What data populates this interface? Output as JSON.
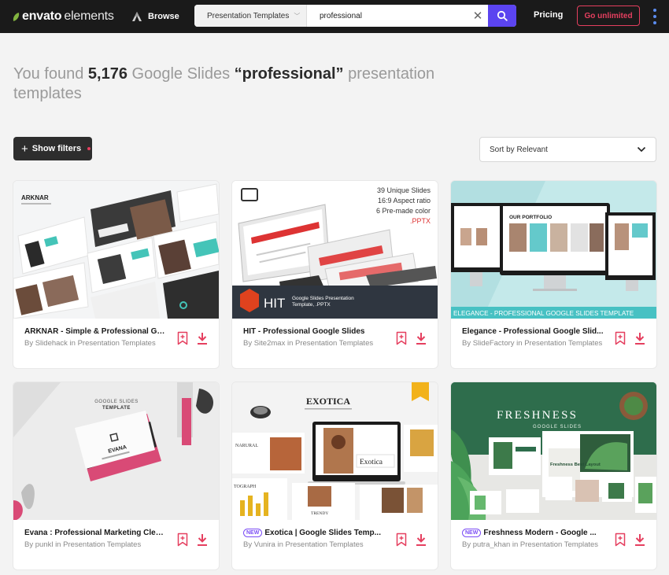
{
  "header": {
    "logo_envato": "envato",
    "logo_elements": "elements",
    "browse_label": "Browse",
    "search_category": "Presentation Templates",
    "search_value": "professional",
    "pricing_label": "Pricing",
    "go_unlimited_label": "Go unlimited"
  },
  "results": {
    "prefix": "You found ",
    "count": "5,176",
    "middle": " Google Slides ",
    "query": "“professional”",
    "suffix": " presentation templates"
  },
  "toolbar": {
    "filters_label": "Show filters",
    "sort_label": "Sort by Relevant"
  },
  "cards": [
    {
      "title": "ARKNAR - Simple & Professional Go...",
      "by": "By Slidehack in Presentation Templates",
      "is_new": false,
      "new_label": ""
    },
    {
      "title": "HIT - Professional Google Slides",
      "by": "By Site2max in Presentation Templates",
      "is_new": false,
      "new_label": "",
      "thumb": {
        "stats": [
          "39 Unique Slides",
          "16:9 Aspect ratio",
          "6 Pre-made color",
          ".PPTX"
        ],
        "brand": "HIT",
        "brand_sub": "Google Slides Presentation Template, .PPTX"
      }
    },
    {
      "title": "Elegance - Professional Google Slid...",
      "by": "By SlideFactory in Presentation Templates",
      "is_new": false,
      "new_label": "",
      "thumb": {
        "screen_title": "OUR PORTFOLIO",
        "banner": "ELEGANCE - PROFESSIONAL GOOGLE SLIDES TEMPLATE"
      }
    },
    {
      "title": "Evana : Professional Marketing Clea...",
      "by": "By punkl in Presentation Templates",
      "is_new": false,
      "new_label": "",
      "thumb": {
        "label_top": "GOOGLE SLIDES",
        "label_bottom": "TEMPLATE",
        "card_name": "EVANA"
      }
    },
    {
      "title": "Exotica | Google Slides Temp...",
      "by": "By Vunira in Presentation Templates",
      "is_new": true,
      "new_label": "NEW",
      "thumb": {
        "name": "EXOTICA",
        "screen_word": "Exotica",
        "side_words": [
          "NARURAL",
          "TOGRAPH",
          "TRENDY"
        ]
      }
    },
    {
      "title": "Freshness Modern - Google ...",
      "by": "By putra_khan in Presentation Templates",
      "is_new": true,
      "new_label": "NEW",
      "thumb": {
        "name": "FRESHNESS",
        "sub": "GOOGLE SLIDES",
        "slide_title": "Freshness Best Layout"
      }
    }
  ],
  "colors": {
    "accent": "#5b44f0",
    "brand_red": "#e53f5f",
    "envato_green": "#82b440"
  }
}
